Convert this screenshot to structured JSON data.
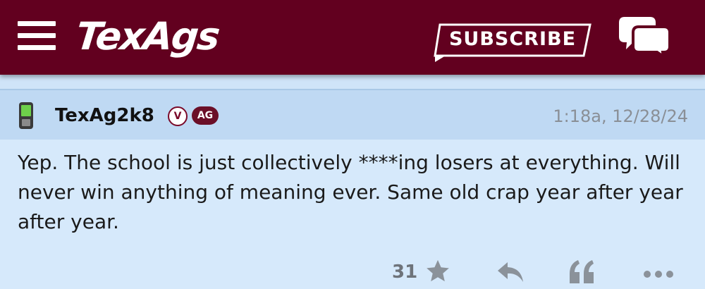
{
  "header": {
    "logo": "TexAgs",
    "subscribe_label": "SUBSCRIBE",
    "icons": [
      "menu-icon",
      "chat-bubbles-icon"
    ],
    "brand_color": "#62001f"
  },
  "post": {
    "username": "TexAg2k8",
    "badges": {
      "v": "V",
      "ag": "AG"
    },
    "timestamp": "1:18a, 12/28/24",
    "text": "Yep. The school is just collectively ****ing losers at everything. Will never win anything of meaning ever. Same old crap year after year after year.",
    "device_icon": "phone-icon",
    "actions": {
      "star_count": "31",
      "icons": [
        "star-icon",
        "reply-icon",
        "quote-icon",
        "more-icon"
      ]
    }
  }
}
